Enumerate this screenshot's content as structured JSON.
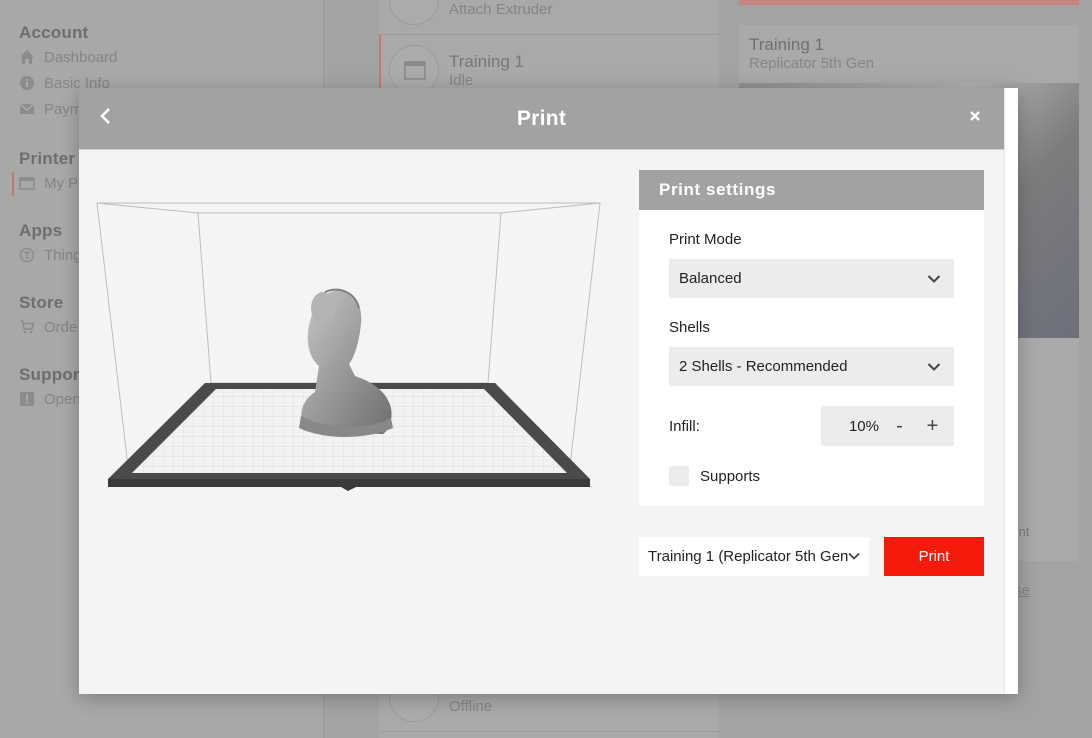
{
  "sidebar": {
    "sections": [
      {
        "title": "Account",
        "items": [
          {
            "label": "Dashboard",
            "icon": "home-icon"
          },
          {
            "label": "Basic Info",
            "icon": "info-icon"
          },
          {
            "label": "Paym",
            "icon": "mail-icon"
          }
        ]
      },
      {
        "title": "Printer",
        "items": [
          {
            "label": "My P",
            "icon": "printer-icon"
          }
        ]
      },
      {
        "title": "Apps",
        "items": [
          {
            "label": "Thing",
            "icon": "thingiverse-icon"
          }
        ]
      },
      {
        "title": "Store",
        "items": [
          {
            "label": "Orde",
            "icon": "cart-icon"
          }
        ]
      },
      {
        "title": "Suppor",
        "items": [
          {
            "label": "Open",
            "icon": "alert-icon"
          }
        ]
      }
    ]
  },
  "printer_list": {
    "items": [
      {
        "name": "",
        "status": "Attach Extruder"
      },
      {
        "name": "Training 1",
        "status": "Idle"
      },
      {
        "name": "",
        "status": "Offline"
      }
    ]
  },
  "detail": {
    "title": "Training 1",
    "subtitle": "Replicator 5th Gen",
    "small_label": "nent",
    "link": "ase"
  },
  "modal": {
    "title": "Print",
    "settings_title": "Print settings",
    "print_mode_label": "Print Mode",
    "print_mode_value": "Balanced",
    "shells_label": "Shells",
    "shells_value": "2 Shells - Recommended",
    "infill_label": "Infill:",
    "infill_value": "10%",
    "infill_minus": "-",
    "infill_plus": "+",
    "supports_label": "Supports",
    "supports_checked": false,
    "printer_value": "Training 1 (Replicator 5th Gen",
    "print_button": "Print"
  },
  "colors": {
    "accent": "#f41a0c",
    "header_gray": "#a2a2a2",
    "selected_marker": "#c8776e"
  }
}
